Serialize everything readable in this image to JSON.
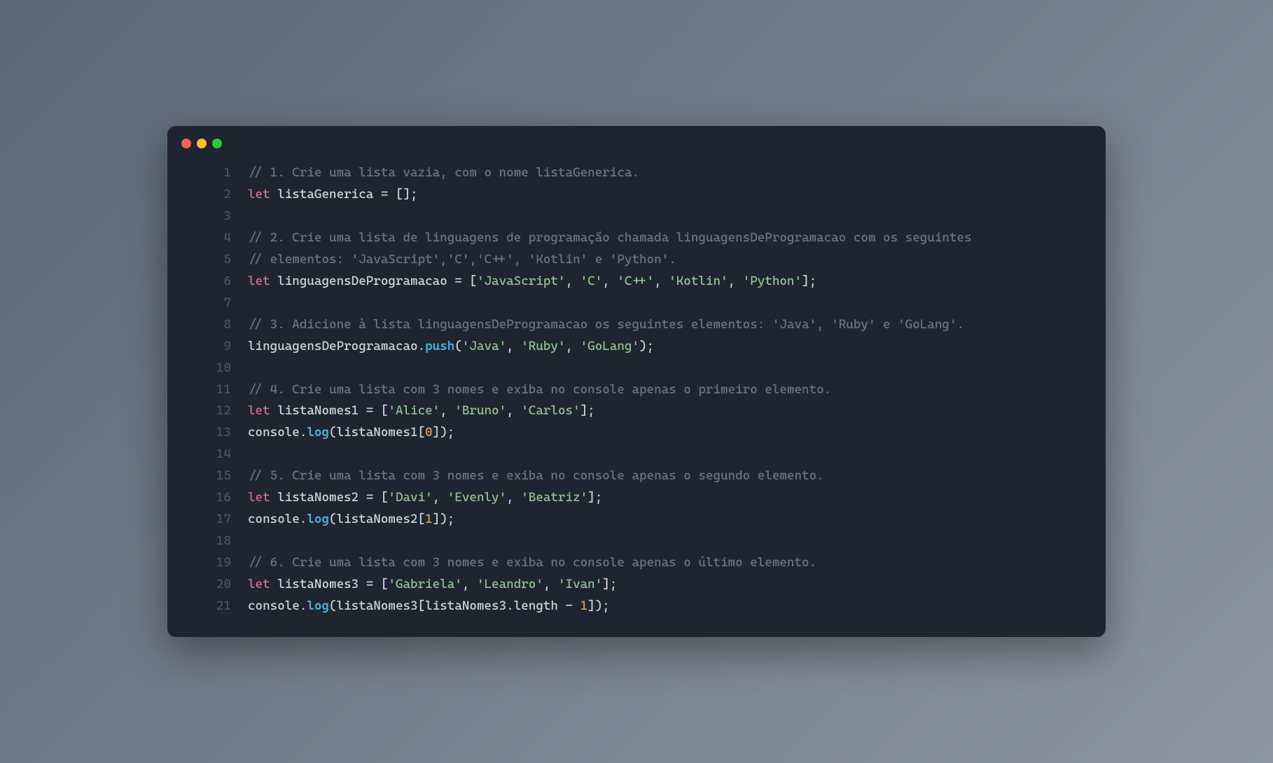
{
  "window": {
    "dots": [
      "red",
      "yellow",
      "green"
    ]
  },
  "code": {
    "lines": [
      {
        "num": "1",
        "tokens": [
          {
            "t": "// 1. Crie uma lista vazia, com o nome listaGenerica.",
            "c": "comment"
          }
        ]
      },
      {
        "num": "2",
        "tokens": [
          {
            "t": "let",
            "c": "keyword"
          },
          {
            "t": " listaGenerica ",
            "c": "var"
          },
          {
            "t": "=",
            "c": "op"
          },
          {
            "t": " [];",
            "c": "punct"
          }
        ]
      },
      {
        "num": "3",
        "tokens": []
      },
      {
        "num": "4",
        "tokens": [
          {
            "t": "// 2. Crie uma lista de linguagens de programação chamada linguagensDeProgramacao com os seguintes",
            "c": "comment"
          }
        ]
      },
      {
        "num": "5",
        "tokens": [
          {
            "t": "// elementos: 'JavaScript','C','C++', 'Kotlin' e 'Python'.",
            "c": "comment"
          }
        ]
      },
      {
        "num": "6",
        "tokens": [
          {
            "t": "let",
            "c": "keyword"
          },
          {
            "t": " linguagensDeProgramacao ",
            "c": "var"
          },
          {
            "t": "=",
            "c": "op"
          },
          {
            "t": " [",
            "c": "punct"
          },
          {
            "t": "'JavaScript'",
            "c": "string"
          },
          {
            "t": ", ",
            "c": "punct"
          },
          {
            "t": "'C'",
            "c": "string"
          },
          {
            "t": ", ",
            "c": "punct"
          },
          {
            "t": "'C++'",
            "c": "string"
          },
          {
            "t": ", ",
            "c": "punct"
          },
          {
            "t": "'Kotlin'",
            "c": "string"
          },
          {
            "t": ", ",
            "c": "punct"
          },
          {
            "t": "'Python'",
            "c": "string"
          },
          {
            "t": "];",
            "c": "punct"
          }
        ]
      },
      {
        "num": "7",
        "tokens": []
      },
      {
        "num": "8",
        "tokens": [
          {
            "t": "// 3. Adicione à lista linguagensDeProgramacao os seguintes elementos: 'Java', 'Ruby' e 'GoLang'.",
            "c": "comment"
          }
        ]
      },
      {
        "num": "9",
        "tokens": [
          {
            "t": "linguagensDeProgramacao.",
            "c": "var"
          },
          {
            "t": "push",
            "c": "method"
          },
          {
            "t": "(",
            "c": "punct"
          },
          {
            "t": "'Java'",
            "c": "string"
          },
          {
            "t": ", ",
            "c": "punct"
          },
          {
            "t": "'Ruby'",
            "c": "string"
          },
          {
            "t": ", ",
            "c": "punct"
          },
          {
            "t": "'GoLang'",
            "c": "string"
          },
          {
            "t": ");",
            "c": "punct"
          }
        ]
      },
      {
        "num": "10",
        "tokens": []
      },
      {
        "num": "11",
        "tokens": [
          {
            "t": "// 4. Crie uma lista com 3 nomes e exiba no console apenas o primeiro elemento.",
            "c": "comment"
          }
        ]
      },
      {
        "num": "12",
        "tokens": [
          {
            "t": "let",
            "c": "keyword"
          },
          {
            "t": " listaNomes1 ",
            "c": "var"
          },
          {
            "t": "=",
            "c": "op"
          },
          {
            "t": " [",
            "c": "punct"
          },
          {
            "t": "'Alice'",
            "c": "string"
          },
          {
            "t": ", ",
            "c": "punct"
          },
          {
            "t": "'Bruno'",
            "c": "string"
          },
          {
            "t": ", ",
            "c": "punct"
          },
          {
            "t": "'Carlos'",
            "c": "string"
          },
          {
            "t": "];",
            "c": "punct"
          }
        ]
      },
      {
        "num": "13",
        "tokens": [
          {
            "t": "console.",
            "c": "var"
          },
          {
            "t": "log",
            "c": "method"
          },
          {
            "t": "(listaNomes1[",
            "c": "punct"
          },
          {
            "t": "0",
            "c": "num"
          },
          {
            "t": "]);",
            "c": "punct"
          }
        ]
      },
      {
        "num": "14",
        "tokens": []
      },
      {
        "num": "15",
        "tokens": [
          {
            "t": "// 5. Crie uma lista com 3 nomes e exiba no console apenas o segundo elemento.",
            "c": "comment"
          }
        ]
      },
      {
        "num": "16",
        "tokens": [
          {
            "t": "let",
            "c": "keyword"
          },
          {
            "t": " listaNomes2 ",
            "c": "var"
          },
          {
            "t": "=",
            "c": "op"
          },
          {
            "t": " [",
            "c": "punct"
          },
          {
            "t": "'Davi'",
            "c": "string"
          },
          {
            "t": ", ",
            "c": "punct"
          },
          {
            "t": "'Evenly'",
            "c": "string"
          },
          {
            "t": ", ",
            "c": "punct"
          },
          {
            "t": "'Beatriz'",
            "c": "string"
          },
          {
            "t": "];",
            "c": "punct"
          }
        ]
      },
      {
        "num": "17",
        "tokens": [
          {
            "t": "console.",
            "c": "var"
          },
          {
            "t": "log",
            "c": "method"
          },
          {
            "t": "(listaNomes2[",
            "c": "punct"
          },
          {
            "t": "1",
            "c": "num"
          },
          {
            "t": "]);",
            "c": "punct"
          }
        ]
      },
      {
        "num": "18",
        "tokens": []
      },
      {
        "num": "19",
        "tokens": [
          {
            "t": "// 6. Crie uma lista com 3 nomes e exiba no console apenas o último elemento.",
            "c": "comment"
          }
        ]
      },
      {
        "num": "20",
        "tokens": [
          {
            "t": "let",
            "c": "keyword"
          },
          {
            "t": " listaNomes3 ",
            "c": "var"
          },
          {
            "t": "=",
            "c": "op"
          },
          {
            "t": " [",
            "c": "punct"
          },
          {
            "t": "'Gabriela'",
            "c": "string"
          },
          {
            "t": ", ",
            "c": "punct"
          },
          {
            "t": "'Leandro'",
            "c": "string"
          },
          {
            "t": ", ",
            "c": "punct"
          },
          {
            "t": "'Ivan'",
            "c": "string"
          },
          {
            "t": "];",
            "c": "punct"
          }
        ]
      },
      {
        "num": "21",
        "tokens": [
          {
            "t": "console.",
            "c": "var"
          },
          {
            "t": "log",
            "c": "method"
          },
          {
            "t": "(listaNomes3[listaNomes3.length ",
            "c": "punct"
          },
          {
            "t": "-",
            "c": "op"
          },
          {
            "t": " ",
            "c": "punct"
          },
          {
            "t": "1",
            "c": "num"
          },
          {
            "t": "]);",
            "c": "punct"
          }
        ]
      }
    ]
  }
}
